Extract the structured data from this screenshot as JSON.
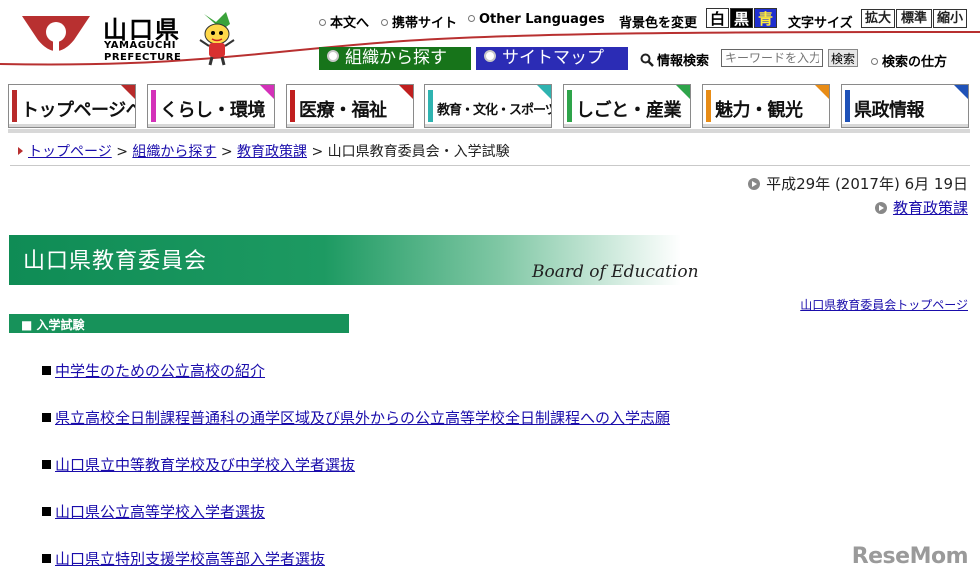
{
  "header": {
    "logo_title": "山口県",
    "logo_en_line1": "YAMAGUCHI",
    "logo_en_line2": "PREFECTURE",
    "util_links": [
      "本文へ",
      "携帯サイト",
      "Other Languages"
    ],
    "bg_color_label": "背景色を変更",
    "bg_colors": [
      "白",
      "黒",
      "青"
    ],
    "text_size_label": "文字サイズ",
    "text_sizes": [
      "拡大",
      "標準",
      "縮小"
    ],
    "organization_button": "組織から探す",
    "sitemap_button": "サイトマップ",
    "search_label": "情報検索",
    "search_placeholder": "キーワードを入力",
    "search_button": "検索",
    "search_help": "検索の仕方",
    "colors": {
      "organization": "#17741a",
      "sitemap": "#2b2cb5",
      "accent_red": "#b83030"
    }
  },
  "nav": {
    "tabs": [
      {
        "label": "トップページへ",
        "color": "#b82a2a"
      },
      {
        "label": "くらし・環境",
        "color": "#d431b9"
      },
      {
        "label": "医療・福祉",
        "color": "#c01f1f"
      },
      {
        "label": "教育・文化・スポーツ",
        "color": "#2fb3b0"
      },
      {
        "label": "しごと・産業",
        "color": "#2ea44a"
      },
      {
        "label": "魅力・観光",
        "color": "#e88c16"
      },
      {
        "label": "県政情報",
        "color": "#1f52b8"
      }
    ]
  },
  "breadcrumb": {
    "items": [
      "トップページ",
      "組織から探す",
      "教育政策課"
    ],
    "separator": ">",
    "current": "山口県教育委員会・入学試験"
  },
  "date_text": "平成29年 (2017年) 6月 19日",
  "dept_link": "教育政策課",
  "banner": {
    "title": "山口県教育委員会",
    "subtitle": "Board of Education"
  },
  "top_link": "山口県教育委員会トップページ",
  "section": {
    "label": "■ 入学試験"
  },
  "links": [
    "中学生のための公立高校の紹介",
    "県立高校全日制課程普通科の通学区域及び県外からの公立高等学校全日制課程への入学志願",
    "山口県立中等教育学校及び中学校入学者選抜",
    "山口県公立高等学校入学者選抜",
    "山口県立特別支援学校高等部入学者選抜"
  ],
  "watermark": "ReseMom"
}
